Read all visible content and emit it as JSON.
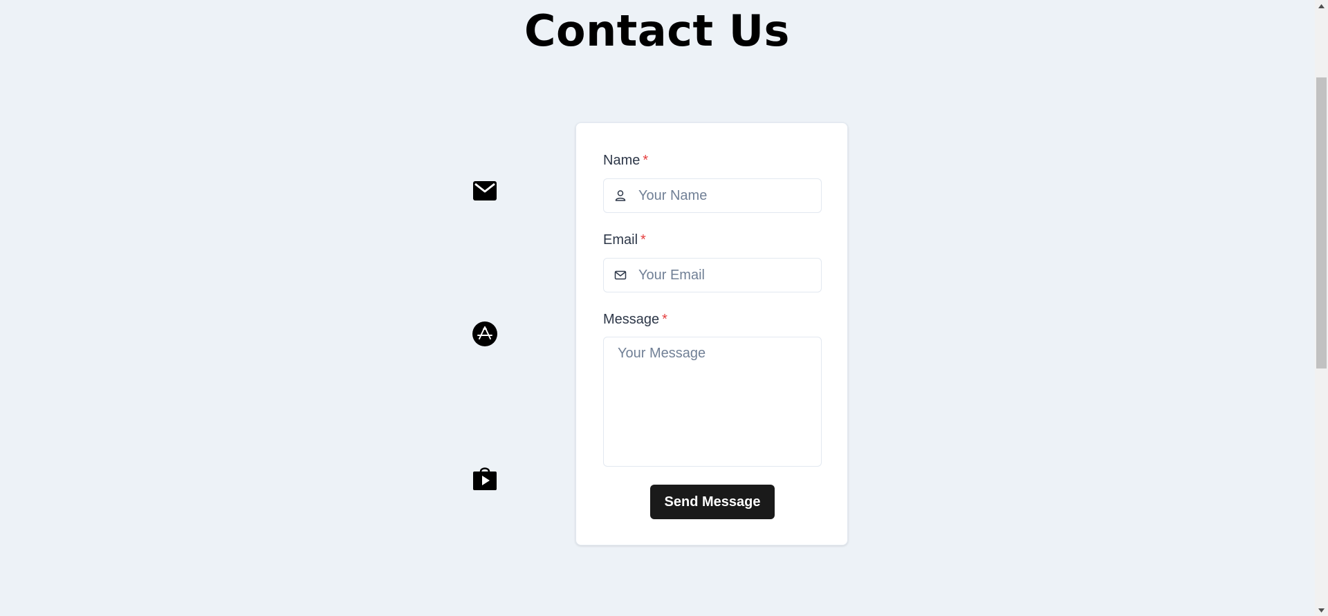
{
  "page": {
    "title": "Contact Us"
  },
  "side_icons": [
    "envelope-icon",
    "app-store-icon",
    "play-store-icon"
  ],
  "form": {
    "name": {
      "label": "Name",
      "required_mark": "*",
      "placeholder": "Your Name",
      "value": "",
      "icon": "user-icon"
    },
    "email": {
      "label": "Email",
      "required_mark": "*",
      "placeholder": "Your Email",
      "value": "",
      "icon": "mail-icon"
    },
    "message": {
      "label": "Message",
      "required_mark": "*",
      "placeholder": "Your Message",
      "value": ""
    },
    "submit_label": "Send Message"
  },
  "colors": {
    "background": "#edf2f7",
    "card": "#ffffff",
    "required": "#e53e3e",
    "button": "#1a1a1a",
    "label": "#2d3748",
    "placeholder": "#718096"
  }
}
